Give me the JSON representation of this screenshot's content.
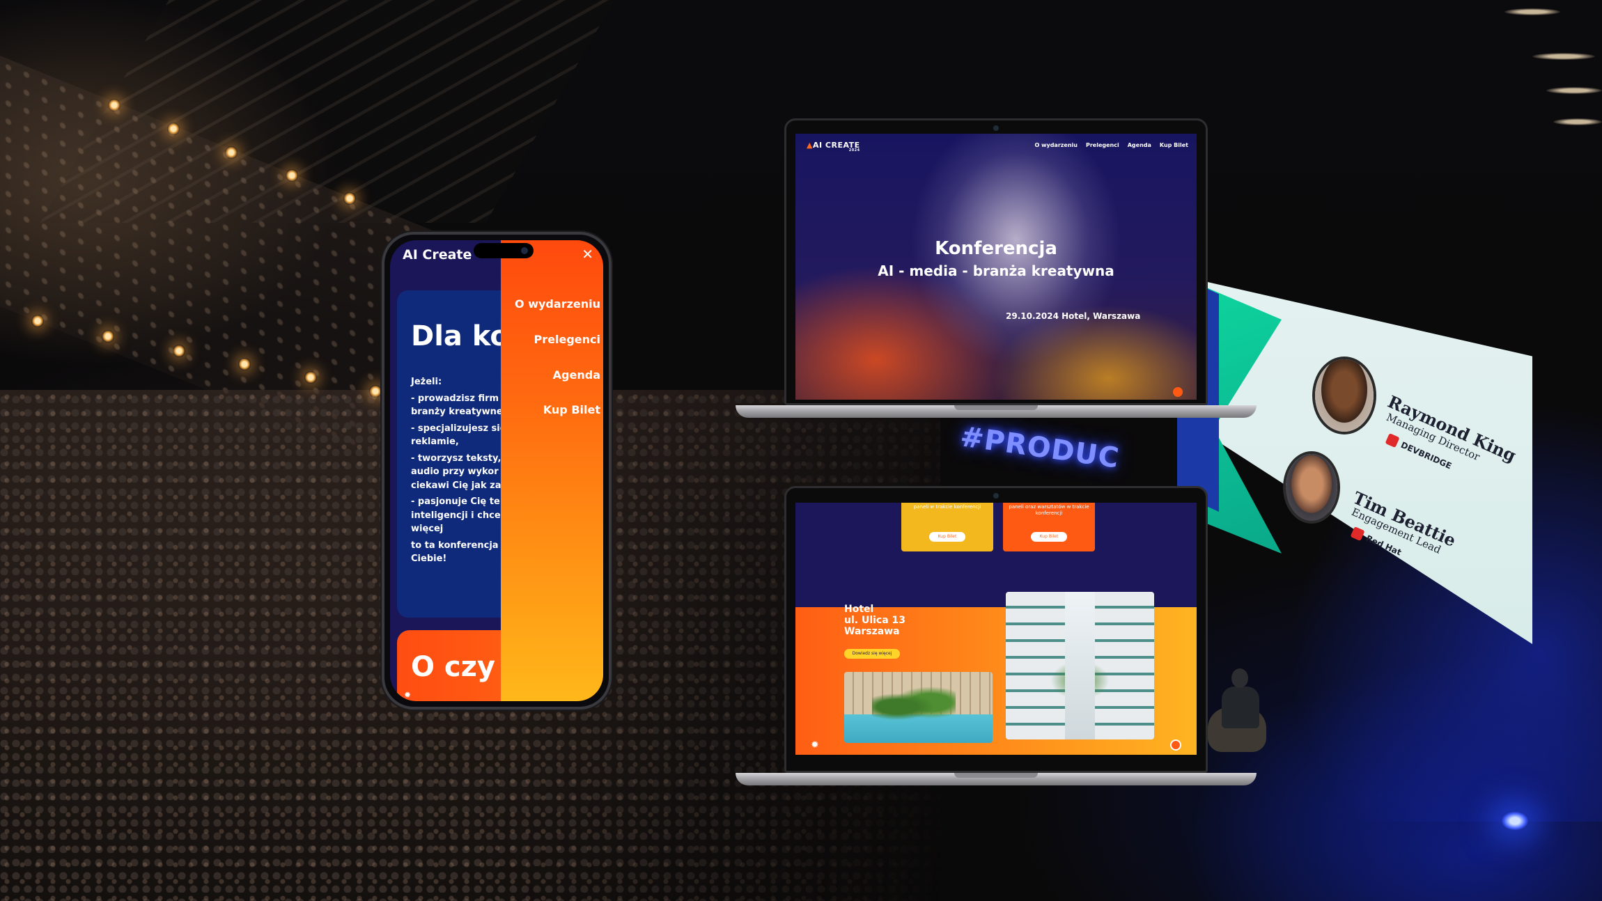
{
  "background": {
    "stage_sign": "#PRODUC",
    "projection": {
      "speakers": [
        {
          "name": "Raymond King",
          "role": "Managing Director",
          "company": "DEVBRIDGE"
        },
        {
          "name": "Tim Beattie",
          "role": "Engagement Lead",
          "company": "Red Hat"
        }
      ]
    }
  },
  "laptop_top": {
    "brand": "AI CREATE",
    "brand_year": "2024",
    "nav": [
      "O wydarzeniu",
      "Prelegenci",
      "Agenda",
      "Kup Bilet"
    ],
    "title": "Konferencja",
    "subtitle": "AI - media - branża kreatywna",
    "date_location": "29.10.2024 Hotel, Warszawa"
  },
  "laptop_bottom": {
    "cards": [
      {
        "text": "paneli w trakcie konferencji",
        "button": "Kup Bilet",
        "color": "#f3b81e"
      },
      {
        "text": "paneli oraz warsztatów w trakcie konferencji",
        "button": "Kup Bilet",
        "color": "#ff5a14"
      }
    ],
    "venue_line1": "Hotel",
    "venue_line2": "ul. Ulica 13",
    "venue_line3": "Warszawa",
    "venue_button": "Dowiedz się więcej"
  },
  "phone": {
    "brand": "AI Create",
    "close_icon": "close-icon",
    "heading": "Dla ko",
    "body": [
      "Jeżeli:",
      "- prowadzisz firm",
      "branży kreatywne",
      "- specjalizujesz się",
      "reklamie,",
      "- tworzysz teksty,",
      "audio przy wykor",
      "ciekawi Cię jak za",
      "- pasjonuje Cię te",
      "inteligencji i chce",
      "więcej",
      "to ta konferencja",
      "Ciebie!"
    ],
    "section_heading": "O czy",
    "menu": [
      "O wydarzeniu",
      "Prelegenci",
      "Agenda",
      "Kup Bilet"
    ],
    "accent": "#ff5a14"
  }
}
